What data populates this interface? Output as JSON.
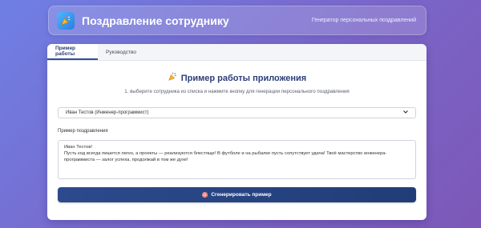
{
  "header": {
    "title": "Поздравление сотруднику",
    "subtitle": "Генератор персональных поздравлений",
    "icon": "party-popper-icon"
  },
  "tabs": [
    {
      "label": "Пример работы",
      "active": true
    },
    {
      "label": "Руководство",
      "active": false
    }
  ],
  "main": {
    "section_icon": "party-popper-icon",
    "section_title": "Пример работы приложения",
    "instruction": "1. выберите сотрудника из списка и нажмите кнопку для генерации персонального поздравления",
    "employee_select": {
      "value": "Иван Тестов (Инженер-программист)"
    },
    "message_label": "Пример поздравления",
    "message_text": "Иван Тестов!\nПусть код всегда пишется легко, а проекты — реализуются блестяще! В футболе и на рыбалке пусть сопутствует удача! Твоё мастерство инженера-программиста — залог успеха, продолжай в том же духе!",
    "generate_button": "Сгенерировать пример",
    "generate_icon": "target-icon"
  },
  "colors": {
    "accent": "#2d3e7a",
    "button": "#2c4a8c"
  }
}
